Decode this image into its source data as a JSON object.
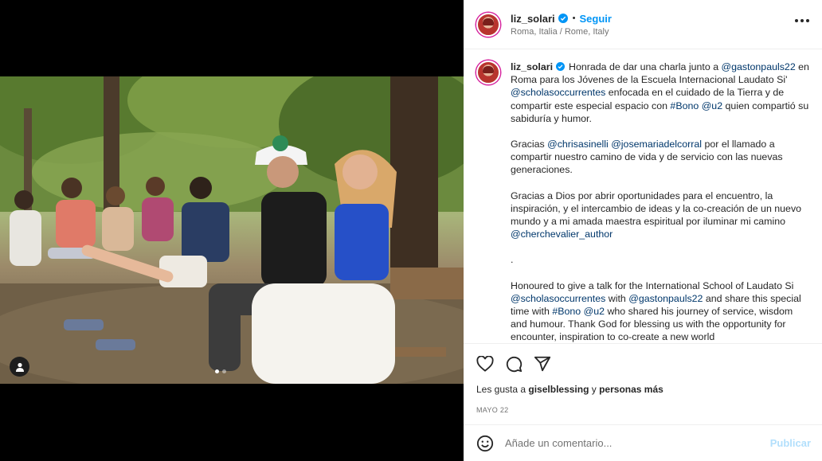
{
  "post": {
    "username": "liz_solari",
    "follow_label": "Seguir",
    "location": "Roma, Italia / Rome, Italy",
    "separator": "•"
  },
  "caption": {
    "username": "liz_solari",
    "p1_a": "Honrada de dar una charla junto a ",
    "p1_m1": "@gastonpauls22",
    "p1_b": " en Roma para los Jóvenes de la Escuela Internacional Laudato Si' ",
    "p1_m2": "@scholasoccurrentes",
    "p1_c": " enfocada en el cuidado de la Tierra y de compartir este especial espacio con ",
    "p1_m3": "#Bono",
    "p1_m4": "@u2",
    "p1_d": " quien compartió su sabiduría y humor.",
    "p2_a": "Gracias ",
    "p2_m1": "@chrisasinelli",
    "p2_m2": "@josemariadelcorral",
    "p2_b": " por el llamado a compartir nuestro camino de vida y de servicio con las nuevas generaciones.",
    "p3_a": "Gracias a Dios por abrir oportunidades para el encuentro, la inspiración, y el intercambio de ideas y la co-creación de un nuevo mundo y a mi amada maestra espiritual por iluminar mi camino ",
    "p3_m1": "@cherchevalier_author",
    "p4": ".",
    "p5_a": "Honoured to give a talk for the International School of Laudato Si ",
    "p5_m1": "@scholasoccurrentes",
    "p5_b": " with ",
    "p5_m2": "@gastonpauls22",
    "p5_c": " and share this special time with ",
    "p5_m3": "#Bono",
    "p5_m4": "@u2",
    "p5_d": " who shared his journey of service, wisdom and humour. Thank God for blessing us with the opportunity for encounter, inspiration to co-create a new world"
  },
  "likes": {
    "prefix": "Les gusta a ",
    "user": "giselblessing",
    "mid": " y ",
    "rest": "personas más"
  },
  "date": "MAYO 22",
  "comment": {
    "placeholder": "Añade un comentario...",
    "publish_label": "Publicar"
  },
  "carousel": {
    "total": 2,
    "active": 1
  },
  "colors": {
    "link": "#00376b",
    "follow": "#0095f6",
    "publish_disabled": "#b2dffc"
  },
  "icons": [
    "verified-badge-icon",
    "more-options-icon",
    "heart-icon",
    "comment-icon",
    "share-icon",
    "emoji-icon",
    "user-tag-icon"
  ]
}
